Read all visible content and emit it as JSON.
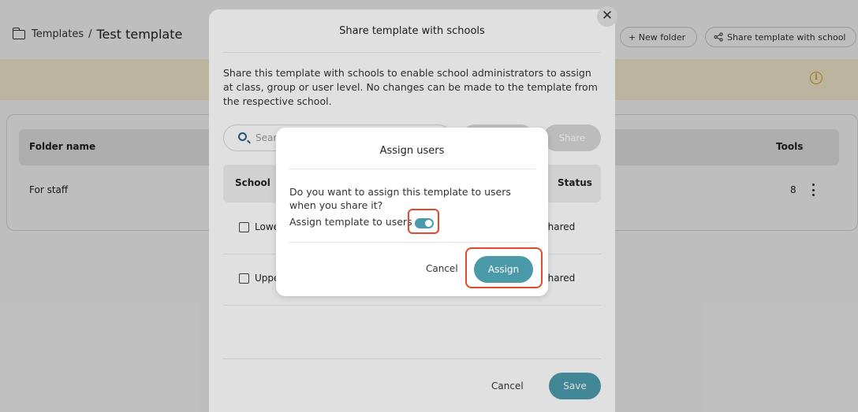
{
  "breadcrumb": {
    "root": "Templates",
    "separator": "/",
    "current": "Test template"
  },
  "toolbar": {
    "new_folder": "+ New folder",
    "share": "Share template with school"
  },
  "table": {
    "headers": {
      "name": "Folder name",
      "tools": "Tools"
    },
    "rows": [
      {
        "name": "For staff",
        "count": "8"
      }
    ]
  },
  "modal": {
    "title": "Share template with schools",
    "description": "Share this template with schools to enable school administrators to assign at class, group or user level. No changes can be made to the template from the respective school.",
    "search_placeholder": "Sear",
    "share_button": "Share",
    "headers": {
      "school": "School",
      "status": "Status"
    },
    "rows": [
      {
        "school": "Lowe",
        "status": "Shared"
      },
      {
        "school": "Uppe",
        "status": "Shared"
      }
    ],
    "cancel": "Cancel",
    "save": "Save"
  },
  "dialog": {
    "title": "Assign users",
    "question": "Do you want to assign this template to users when you share it?",
    "toggle_label": "Assign template to users",
    "toggle_on": true,
    "cancel": "Cancel",
    "assign": "Assign"
  },
  "colors": {
    "accent": "#4a9aaa",
    "highlight": "#e04a2f",
    "warning_band": "#fbf3d8"
  }
}
